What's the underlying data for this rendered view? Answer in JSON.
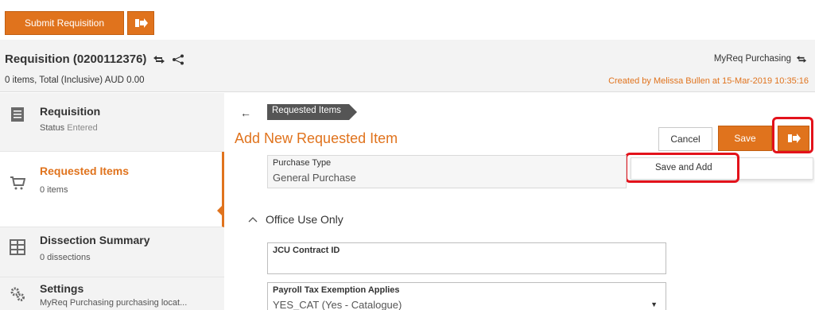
{
  "toolbar": {
    "submit_label": "Submit Requisition",
    "more_icon": "forward-arrow-icon"
  },
  "header": {
    "title": "Requisition (0200112376)",
    "summary": "0 items, Total (Inclusive) AUD 0.00",
    "workflow": "MyReq Purchasing",
    "created_prefix": "Created by ",
    "created_by": "Melissa Bullen",
    "created_at": " at 15-Mar-2019 10:35:16"
  },
  "sidebar": {
    "items": [
      {
        "title": "Requisition",
        "status_label": "Status ",
        "status_value": "Entered",
        "icon": "document-icon"
      },
      {
        "title": "Requested Items",
        "sub": "0 items",
        "icon": "cart-icon",
        "active": true
      },
      {
        "title": "Dissection Summary",
        "sub": "0 dissections",
        "icon": "grid-icon"
      },
      {
        "title": "Settings",
        "sub": "MyReq Purchasing purchasing locat...",
        "icon": "gears-icon"
      }
    ]
  },
  "main": {
    "back_icon": "back-arrow-icon",
    "breadcrumb": "Requested Items",
    "title": "Add New Requested Item",
    "cancel_label": "Cancel",
    "save_label": "Save",
    "dropdown_option": "Save and Add",
    "purchase_type": {
      "label": "Purchase Type",
      "value": "General Purchase"
    },
    "section": "Office Use Only",
    "contract": {
      "label": "JCU Contract ID",
      "value": ""
    },
    "payroll": {
      "label": "Payroll Tax Exemption Applies",
      "value": "YES_CAT (Yes - Catalogue)"
    }
  },
  "colors": {
    "accent": "#e0731d",
    "highlight": "#e3121b"
  }
}
